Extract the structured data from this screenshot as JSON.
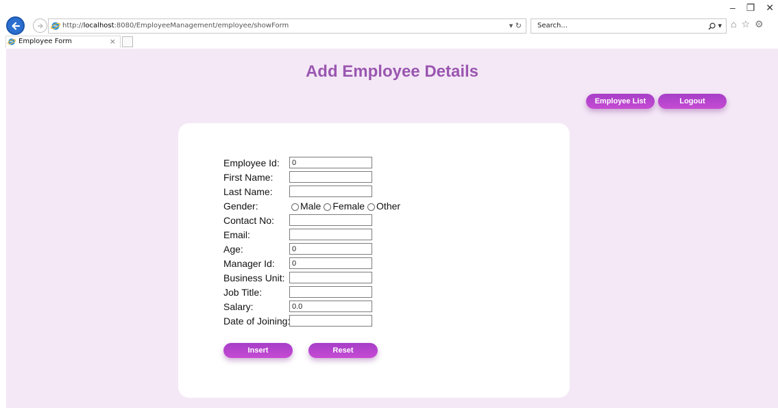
{
  "browser": {
    "url_prefix": "http://",
    "url_host": "localhost",
    "url_rest": ":8080/EmployeeManagement/employee/showForm",
    "url_dropdown": "▾",
    "refresh_icon": "refresh-icon",
    "search_placeholder": "Search...",
    "search_icon": "search-icon",
    "tab_title": "Employee Form",
    "tab_close": "×",
    "window_minimize": "–",
    "window_restore": "❐",
    "window_close": "✕",
    "tool_home": "⌂",
    "tool_favorites": "☆",
    "tool_settings": "⚙"
  },
  "page": {
    "title": "Add Employee Details",
    "nav": {
      "employee_list": "Employee List",
      "logout": "Logout"
    },
    "form": {
      "fields": [
        {
          "label": "Employee Id:",
          "value": "0"
        },
        {
          "label": "First Name:",
          "value": ""
        },
        {
          "label": "Last Name:",
          "value": ""
        },
        {
          "label": "Gender:",
          "options": [
            "Male",
            "Female",
            "Other"
          ]
        },
        {
          "label": "Contact No:",
          "value": ""
        },
        {
          "label": "Email:",
          "value": ""
        },
        {
          "label": "Age:",
          "value": "0"
        },
        {
          "label": "Manager Id:",
          "value": "0"
        },
        {
          "label": "Business Unit:",
          "value": ""
        },
        {
          "label": "Job Title:",
          "value": ""
        },
        {
          "label": "Salary:",
          "value": "0.0"
        },
        {
          "label": "Date of Joining:",
          "value": ""
        }
      ],
      "insert_label": "Insert",
      "reset_label": "Reset"
    }
  },
  "colors": {
    "page_background": "#f4e8f6",
    "title": "#9a56b0",
    "button_gradient_start": "#a63ec7",
    "button_gradient_end": "#c64bd3"
  }
}
